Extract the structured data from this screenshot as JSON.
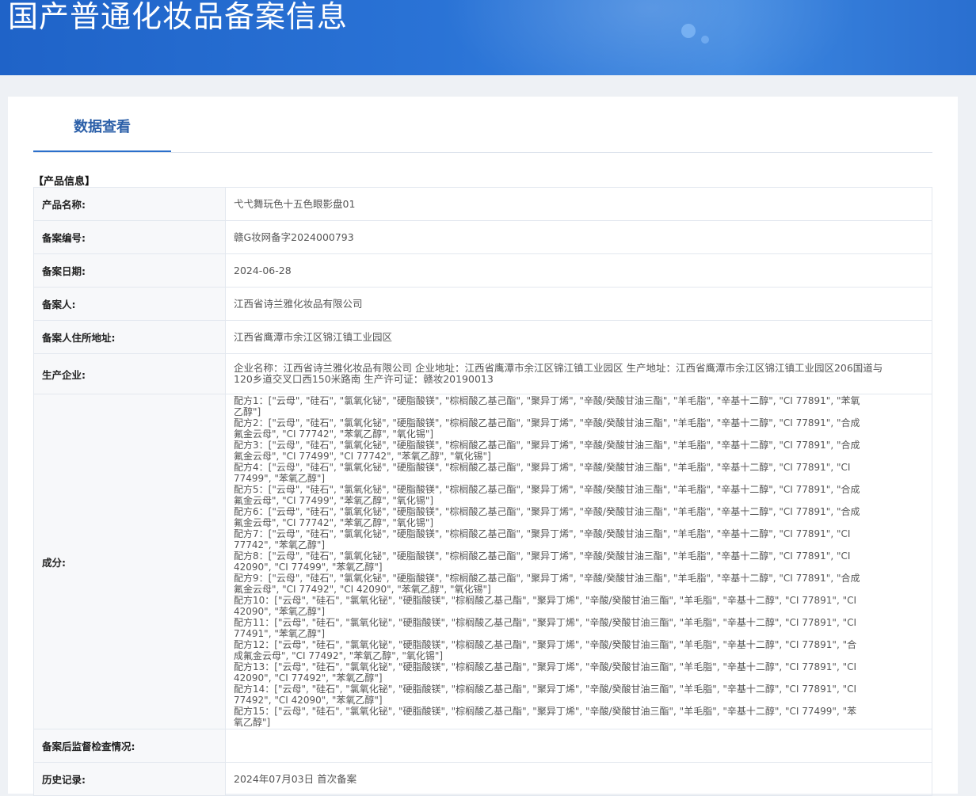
{
  "header": {
    "title": "国产普通化妆品备案信息"
  },
  "tabs": [
    {
      "label": "数据查看"
    }
  ],
  "section_title": "【产品信息】",
  "fields": {
    "product_name": {
      "label": "产品名称:",
      "value": "弋弋舞玩色十五色眼影盘01"
    },
    "record_no": {
      "label": "备案编号:",
      "value": "赣G妆网备字2024000793"
    },
    "record_date": {
      "label": "备案日期:",
      "value": "2024-06-28"
    },
    "registrant": {
      "label": "备案人:",
      "value": "江西省诗兰雅化妆品有限公司"
    },
    "registrant_address": {
      "label": "备案人住所地址:",
      "value": "江西省鹰潭市余江区锦江镇工业园区"
    },
    "manufacturer": {
      "label": "生产企业:",
      "value": "企业名称：江西省诗兰雅化妆品有限公司 企业地址：江西省鹰潭市余江区锦江镇工业园区 生产地址：江西省鹰潭市余江区锦江镇工业园区206国道与120乡道交叉口西150米路南 生产许可证：赣妆20190013"
    },
    "ingredients": {
      "label": "成分:",
      "formulas": [
        "配方1：[\"云母\", \"硅石\", \"氯氧化铋\", \"硬脂酸镁\", \"棕榈酸乙基己酯\", \"聚异丁烯\", \"辛酸/癸酸甘油三酯\", \"羊毛脂\", \"辛基十二醇\", \"CI 77891\", \"苯氧乙醇\"]",
        "配方2：[\"云母\", \"硅石\", \"氯氧化铋\", \"硬脂酸镁\", \"棕榈酸乙基己酯\", \"聚异丁烯\", \"辛酸/癸酸甘油三酯\", \"羊毛脂\", \"辛基十二醇\", \"CI 77891\", \"合成氟金云母\", \"CI 77742\", \"苯氧乙醇\", \"氧化锡\"]",
        "配方3：[\"云母\", \"硅石\", \"氯氧化铋\", \"硬脂酸镁\", \"棕榈酸乙基己酯\", \"聚异丁烯\", \"辛酸/癸酸甘油三酯\", \"羊毛脂\", \"辛基十二醇\", \"CI 77891\", \"合成氟金云母\", \"CI 77499\", \"CI 77742\", \"苯氧乙醇\", \"氧化锡\"]",
        "配方4：[\"云母\", \"硅石\", \"氯氧化铋\", \"硬脂酸镁\", \"棕榈酸乙基己酯\", \"聚异丁烯\", \"辛酸/癸酸甘油三酯\", \"羊毛脂\", \"辛基十二醇\", \"CI 77891\", \"CI 77499\", \"苯氧乙醇\"]",
        "配方5：[\"云母\", \"硅石\", \"氯氧化铋\", \"硬脂酸镁\", \"棕榈酸乙基己酯\", \"聚异丁烯\", \"辛酸/癸酸甘油三酯\", \"羊毛脂\", \"辛基十二醇\", \"CI 77891\", \"合成氟金云母\", \"CI 77499\", \"苯氧乙醇\", \"氧化锡\"]",
        "配方6：[\"云母\", \"硅石\", \"氯氧化铋\", \"硬脂酸镁\", \"棕榈酸乙基己酯\", \"聚异丁烯\", \"辛酸/癸酸甘油三酯\", \"羊毛脂\", \"辛基十二醇\", \"CI 77891\", \"合成氟金云母\", \"CI 77742\", \"苯氧乙醇\", \"氧化锡\"]",
        "配方7：[\"云母\", \"硅石\", \"氯氧化铋\", \"硬脂酸镁\", \"棕榈酸乙基己酯\", \"聚异丁烯\", \"辛酸/癸酸甘油三酯\", \"羊毛脂\", \"辛基十二醇\", \"CI 77891\", \"CI 77742\", \"苯氧乙醇\"]",
        "配方8：[\"云母\", \"硅石\", \"氯氧化铋\", \"硬脂酸镁\", \"棕榈酸乙基己酯\", \"聚异丁烯\", \"辛酸/癸酸甘油三酯\", \"羊毛脂\", \"辛基十二醇\", \"CI 77891\", \"CI 42090\", \"CI 77499\", \"苯氧乙醇\"]",
        "配方9：[\"云母\", \"硅石\", \"氯氧化铋\", \"硬脂酸镁\", \"棕榈酸乙基己酯\", \"聚异丁烯\", \"辛酸/癸酸甘油三酯\", \"羊毛脂\", \"辛基十二醇\", \"CI 77891\", \"合成氟金云母\", \"CI 77492\", \"CI 42090\", \"苯氧乙醇\", \"氧化锡\"]",
        "配方10：[\"云母\", \"硅石\", \"氯氧化铋\", \"硬脂酸镁\", \"棕榈酸乙基己酯\", \"聚异丁烯\", \"辛酸/癸酸甘油三酯\", \"羊毛脂\", \"辛基十二醇\", \"CI 77891\", \"CI 42090\", \"苯氧乙醇\"]",
        "配方11：[\"云母\", \"硅石\", \"氯氧化铋\", \"硬脂酸镁\", \"棕榈酸乙基己酯\", \"聚异丁烯\", \"辛酸/癸酸甘油三酯\", \"羊毛脂\", \"辛基十二醇\", \"CI 77891\", \"CI 77491\", \"苯氧乙醇\"]",
        "配方12：[\"云母\", \"硅石\", \"氯氧化铋\", \"硬脂酸镁\", \"棕榈酸乙基己酯\", \"聚异丁烯\", \"辛酸/癸酸甘油三酯\", \"羊毛脂\", \"辛基十二醇\", \"CI 77891\", \"合成氟金云母\", \"CI 77492\", \"苯氧乙醇\", \"氧化锡\"]",
        "配方13：[\"云母\", \"硅石\", \"氯氧化铋\", \"硬脂酸镁\", \"棕榈酸乙基己酯\", \"聚异丁烯\", \"辛酸/癸酸甘油三酯\", \"羊毛脂\", \"辛基十二醇\", \"CI 77891\", \"CI 42090\", \"CI 77492\", \"苯氧乙醇\"]",
        "配方14：[\"云母\", \"硅石\", \"氯氧化铋\", \"硬脂酸镁\", \"棕榈酸乙基己酯\", \"聚异丁烯\", \"辛酸/癸酸甘油三酯\", \"羊毛脂\", \"辛基十二醇\", \"CI 77891\", \"CI 77492\", \"CI 42090\", \"苯氧乙醇\"]",
        "配方15：[\"云母\", \"硅石\", \"氯氧化铋\", \"硬脂酸镁\", \"棕榈酸乙基己酯\", \"聚异丁烯\", \"辛酸/癸酸甘油三酯\", \"羊毛脂\", \"辛基十二醇\", \"CI 77499\", \"苯氧乙醇\"]"
      ]
    },
    "post_inspection": {
      "label": "备案后监督检查情况:",
      "value": ""
    },
    "history": {
      "label": "历史记录:",
      "value": "2024年07月03日 首次备案"
    }
  },
  "colors": {
    "banner": "#2a73d6",
    "accent": "#2b6fcb",
    "tab_text": "#2b5fa8"
  }
}
